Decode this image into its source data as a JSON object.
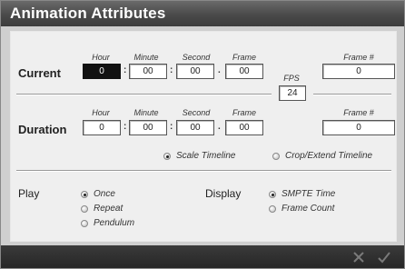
{
  "window": {
    "title": "Animation Attributes"
  },
  "current": {
    "label": "Current",
    "hour": "0",
    "minute": "00",
    "second": "00",
    "frame": "00",
    "frame_num": "0"
  },
  "duration": {
    "label": "Duration",
    "hour": "0",
    "minute": "00",
    "second": "00",
    "frame": "00",
    "frame_num": "0"
  },
  "columns": {
    "hour": "Hour",
    "minute": "Minute",
    "second": "Second",
    "frame": "Frame",
    "frame_num": "Frame #"
  },
  "separators": {
    "colon": ":",
    "dot": "."
  },
  "fps": {
    "label": "FPS",
    "value": "24"
  },
  "timeline": {
    "scale": {
      "label": "Scale Timeline",
      "selected": true
    },
    "crop": {
      "label": "Crop/Extend Timeline",
      "selected": false
    }
  },
  "play": {
    "label": "Play",
    "options": [
      {
        "label": "Once",
        "selected": true
      },
      {
        "label": "Repeat",
        "selected": false
      },
      {
        "label": "Pendulum",
        "selected": false
      }
    ]
  },
  "display": {
    "label": "Display",
    "options": [
      {
        "label": "SMPTE Time",
        "selected": true
      },
      {
        "label": "Frame Count",
        "selected": false
      }
    ]
  },
  "footer": {
    "cancel_icon": "cancel-x-icon",
    "ok_icon": "checkmark-icon"
  }
}
